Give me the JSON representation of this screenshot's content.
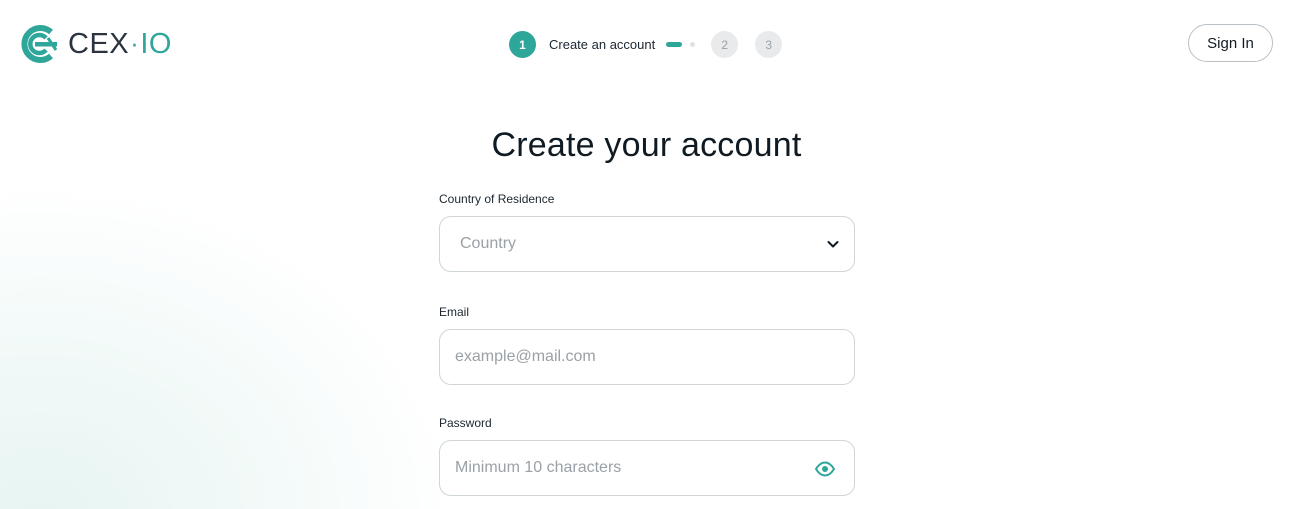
{
  "brand": {
    "name_part1": "CEX",
    "separator": "·",
    "name_part2": "IO",
    "accent_color": "#2fa69a",
    "icon": "cex-logo-icon"
  },
  "stepper": {
    "steps": [
      {
        "number": "1",
        "label": "Create an account",
        "state": "active"
      },
      {
        "number": "2",
        "label": "",
        "state": "inactive"
      },
      {
        "number": "3",
        "label": "",
        "state": "inactive"
      }
    ],
    "current_step_progress": {
      "filled_segments": 1,
      "total_segments": 2
    }
  },
  "header": {
    "sign_in_label": "Sign In"
  },
  "form": {
    "title": "Create your account",
    "country": {
      "label": "Country of Residence",
      "placeholder": "Country",
      "icon": "chevron-down-icon"
    },
    "email": {
      "label": "Email",
      "placeholder": "example@mail.com",
      "value": ""
    },
    "password": {
      "label": "Password",
      "placeholder": "Minimum 10 characters",
      "value": "",
      "icon": "eye-icon"
    }
  }
}
